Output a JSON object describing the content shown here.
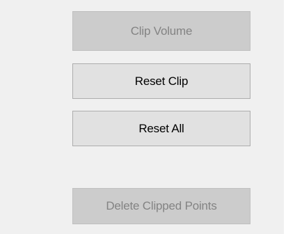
{
  "buttons": {
    "clip_volume": {
      "label": "Clip Volume",
      "enabled": false
    },
    "reset_clip": {
      "label": "Reset Clip",
      "enabled": true
    },
    "reset_all": {
      "label": "Reset All",
      "enabled": true
    },
    "delete_clipped_points": {
      "label": "Delete Clipped Points",
      "enabled": false
    }
  },
  "colors": {
    "panel_background": "#f0f0f0",
    "button_face": "#e1e1e1",
    "button_border": "#adadad",
    "disabled_face": "#cccccc",
    "disabled_text": "#838383"
  }
}
